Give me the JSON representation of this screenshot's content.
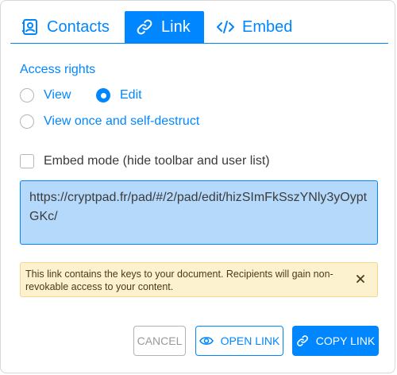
{
  "tabs": [
    {
      "label": "Contacts",
      "icon": "contacts-icon"
    },
    {
      "label": "Link",
      "icon": "link-icon",
      "active": true
    },
    {
      "label": "Embed",
      "icon": "code-icon"
    }
  ],
  "access": {
    "label": "Access rights",
    "options": [
      {
        "label": "View",
        "checked": false
      },
      {
        "label": "Edit",
        "checked": true
      },
      {
        "label": "View once and self-destruct",
        "checked": false
      }
    ]
  },
  "embed_mode": {
    "label": "Embed mode (hide toolbar and user list)",
    "checked": false
  },
  "link_url": "https://cryptpad.fr/pad/#/2/pad/edit/hizSImFkSszYNly3yOyptGKc/",
  "warning": {
    "text": "This link contains the keys to your document. Recipients will gain non-revokable access to your content."
  },
  "buttons": {
    "cancel": "CANCEL",
    "open_link": "OPEN LINK",
    "copy_link": "COPY LINK"
  },
  "colors": {
    "accent": "#0087ff",
    "link_box_bg": "#b5d9fa",
    "warning_bg": "#fdf2d0"
  }
}
